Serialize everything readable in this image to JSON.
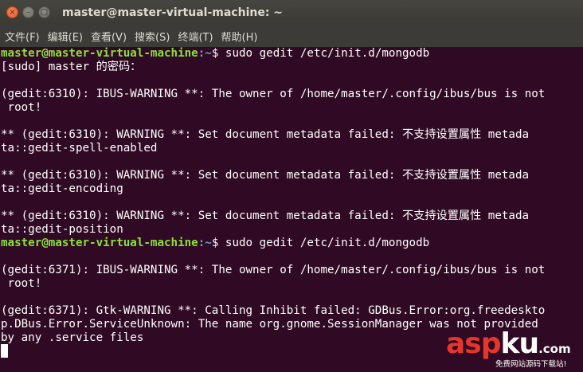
{
  "window": {
    "title": "master@master-virtual-machine: ~",
    "close_icon": "×",
    "minimize_icon": "–",
    "maximize_icon": "□"
  },
  "menu": [
    {
      "label": "文件(F)"
    },
    {
      "label": "编辑(E)"
    },
    {
      "label": "查看(V)"
    },
    {
      "label": "搜索(S)"
    },
    {
      "label": "终端(T)"
    },
    {
      "label": "帮助(H)"
    }
  ],
  "prompt": {
    "user": "master@master-virtual-machine",
    "path": ":~",
    "symbol": "$ "
  },
  "colors": {
    "background": "#300a24",
    "prompt_user": "#8ae234",
    "prompt_path": "#729fcf",
    "text": "#ffffff"
  },
  "terminal": {
    "cmd1": "sudo gedit /etc/init.d/mongodb",
    "line1": "[sudo] master 的密码：",
    "line2": "",
    "line3": "(gedit:6310): IBUS-WARNING **: The owner of /home/master/.config/ibus/bus is not",
    "line4": " root!",
    "line5": "",
    "line6": "** (gedit:6310): WARNING **: Set document metadata failed: 不支持设置属性 metada",
    "line7": "ta::gedit-spell-enabled",
    "line8": "",
    "line9": "** (gedit:6310): WARNING **: Set document metadata failed: 不支持设置属性 metada",
    "line10": "ta::gedit-encoding",
    "line11": "",
    "line12": "** (gedit:6310): WARNING **: Set document metadata failed: 不支持设置属性 metada",
    "line13": "ta::gedit-position",
    "cmd2": "sudo gedit /etc/init.d/mongodb",
    "line15": "",
    "line16": "(gedit:6371): IBUS-WARNING **: The owner of /home/master/.config/ibus/bus is not",
    "line17": " root!",
    "line18": "",
    "line19": "(gedit:6371): Gtk-WARNING **: Calling Inhibit failed: GDBus.Error:org.freedeskto",
    "line20": "p.DBus.Error.ServiceUnknown: The name org.gnome.SessionManager was not provided",
    "line21": "by any .service files"
  },
  "watermark": {
    "part1": "asp",
    "part2": "ku",
    "suffix": ".com",
    "tagline": "免费网站源码下载站!"
  }
}
